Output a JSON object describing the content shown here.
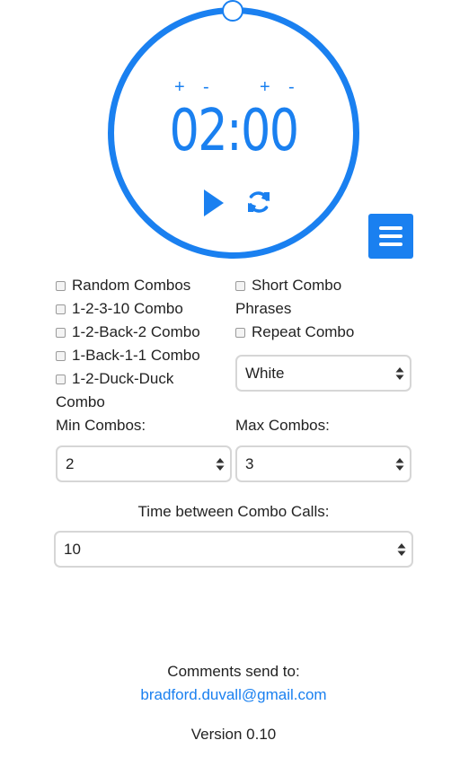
{
  "colors": {
    "accent": "#1a80f0",
    "text": "#222222",
    "select_border": "#d6d6d6"
  },
  "timer": {
    "time": "02:00",
    "plus": "+",
    "minus": "-",
    "icons": {
      "play": "play-icon",
      "reset": "refresh-icon",
      "menu": "hamburger-menu-icon"
    }
  },
  "options": {
    "random_combos": "Random Combos",
    "combo_1_2_3_10": "1-2-3-10 Combo",
    "combo_1_2_back_2": "1-2-Back-2 Combo",
    "combo_1_back_1_1": "1-Back-1-1 Combo",
    "combo_duck_line1": "1-2-Duck-Duck",
    "combo_duck_line2": "Combo",
    "short_combo_line1": "Short Combo",
    "short_combo_line2": "Phrases",
    "repeat_combo": "Repeat Combo",
    "color_select_value": "White"
  },
  "combos": {
    "min_label": "Min Combos:",
    "min_value": "2",
    "max_label": "Max Combos:",
    "max_value": "3"
  },
  "time_between": {
    "label": "Time between Combo Calls:",
    "value": "10"
  },
  "footer": {
    "comments": "Comments send to:",
    "email": "bradford.duvall@gmail.com",
    "version": "Version 0.10"
  }
}
